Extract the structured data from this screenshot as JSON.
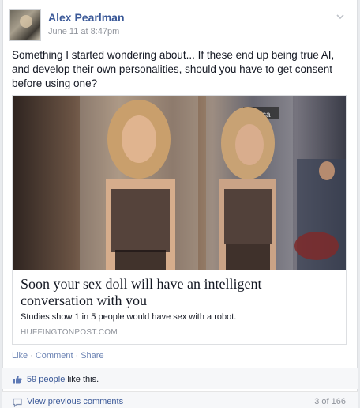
{
  "post": {
    "author": "Alex Pearlman",
    "timestamp": "June 11 at 8:47pm",
    "text": "Something I started wondering about... If these end up being true AI, and develop their own personalities, should you have to get consent before using one?"
  },
  "link_preview": {
    "title": "Soon your sex doll will have an intelligent conversation with you",
    "description": "Studies show 1 in 5 people would have sex with a robot.",
    "domain": "HUFFINGTONPOST.COM",
    "image_sign_text": "jessica"
  },
  "actions": {
    "like": "Like",
    "comment": "Comment",
    "share": "Share",
    "separator": "·"
  },
  "likes": {
    "count_link": "59 people",
    "suffix": " like this."
  },
  "comments": {
    "view_previous": "View previous comments",
    "page_count": "3 of 166"
  },
  "colors": {
    "brand_link": "#3b5998",
    "action_link": "#6d84b4",
    "meta_gray": "#90949c"
  },
  "icons": {
    "options": "chevron-down-icon",
    "like": "thumbs-up-icon",
    "comment": "comment-bubble-icon"
  }
}
